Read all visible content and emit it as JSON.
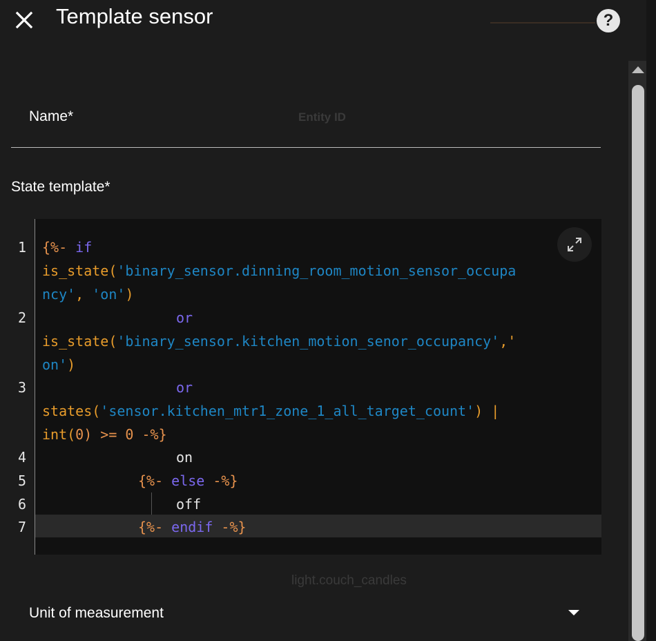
{
  "header": {
    "title": "Template sensor",
    "close_icon": "close-icon",
    "help_icon": "help-icon",
    "help_glyph": "?"
  },
  "form": {
    "name_label": "Name*",
    "entity_id_hint": "Entity ID",
    "state_template_label": "State template*",
    "background_hint": "light.couch_candles",
    "unit_label": "Unit of measurement"
  },
  "editor": {
    "line_numbers": [
      "1",
      "2",
      "3",
      "4",
      "5",
      "6",
      "7"
    ],
    "line1": {
      "open": "{%- ",
      "kw": "if"
    },
    "line1b": {
      "fn": "is_state(",
      "str": "'binary_sensor.dinning_room_motion_sensor_occupa"
    },
    "line1c": {
      "str": "ncy'",
      "sep": ", ",
      "str2": "'on'",
      "close": ")"
    },
    "line2": {
      "kw": "or"
    },
    "line2b": {
      "fn": "is_state(",
      "str": "'binary_sensor.kitchen_motion_senor_occupancy'",
      "sep": ",'"
    },
    "line2c": {
      "str": "on'",
      "close": ")"
    },
    "line3": {
      "kw": "or"
    },
    "line3b": {
      "fn": "states(",
      "str": "'sensor.kitchen_mtr1_zone_1_all_target_count'",
      "close": ") |"
    },
    "line3c": {
      "fn": "int(",
      "num": "0",
      "rest": ") >= 0 -%}"
    },
    "line4": {
      "text": "on"
    },
    "line5": {
      "open": "{%- ",
      "kw": "else",
      "close": " -%}"
    },
    "line6": {
      "text": "off"
    },
    "line7": {
      "open": "{%- ",
      "kw": "endif",
      "close": " -%}"
    },
    "expand_icon": "expand-icon"
  },
  "colors": {
    "background": "#1c1c1c",
    "editor_bg": "#111111",
    "bracket": "#e7924d",
    "keyword": "#7b68ee",
    "function": "#e89c2b",
    "string": "#1e86c4"
  }
}
